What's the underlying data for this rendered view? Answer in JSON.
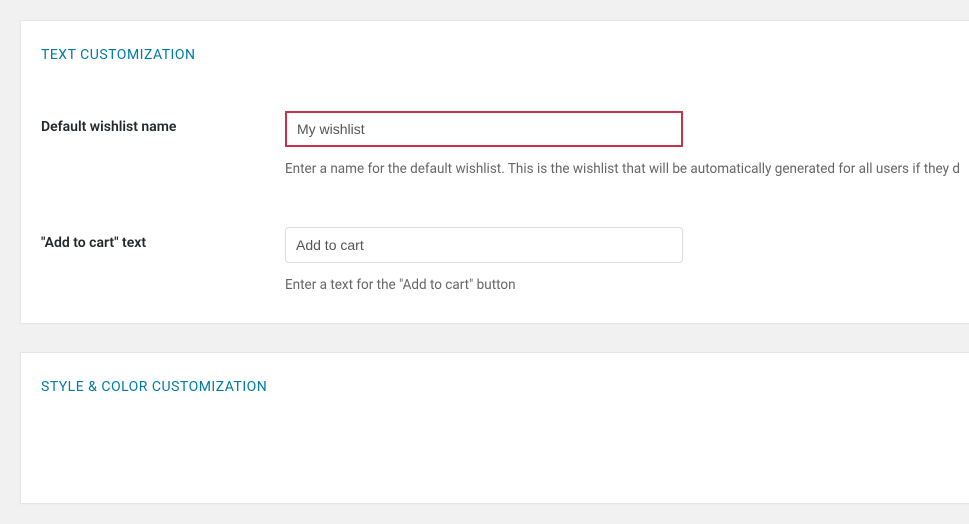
{
  "sections": {
    "text_customization": {
      "title": "TEXT CUSTOMIZATION",
      "fields": {
        "default_wishlist_name": {
          "label": "Default wishlist name",
          "value": "My wishlist",
          "help": "Enter a name for the default wishlist. This is the wishlist that will be automatically generated for all users if they d"
        },
        "add_to_cart_text": {
          "label": "\"Add to cart\" text",
          "value": "Add to cart",
          "help": "Enter a text for the \"Add to cart\" button"
        }
      }
    },
    "style_color": {
      "title": "STYLE & COLOR CUSTOMIZATION"
    }
  }
}
